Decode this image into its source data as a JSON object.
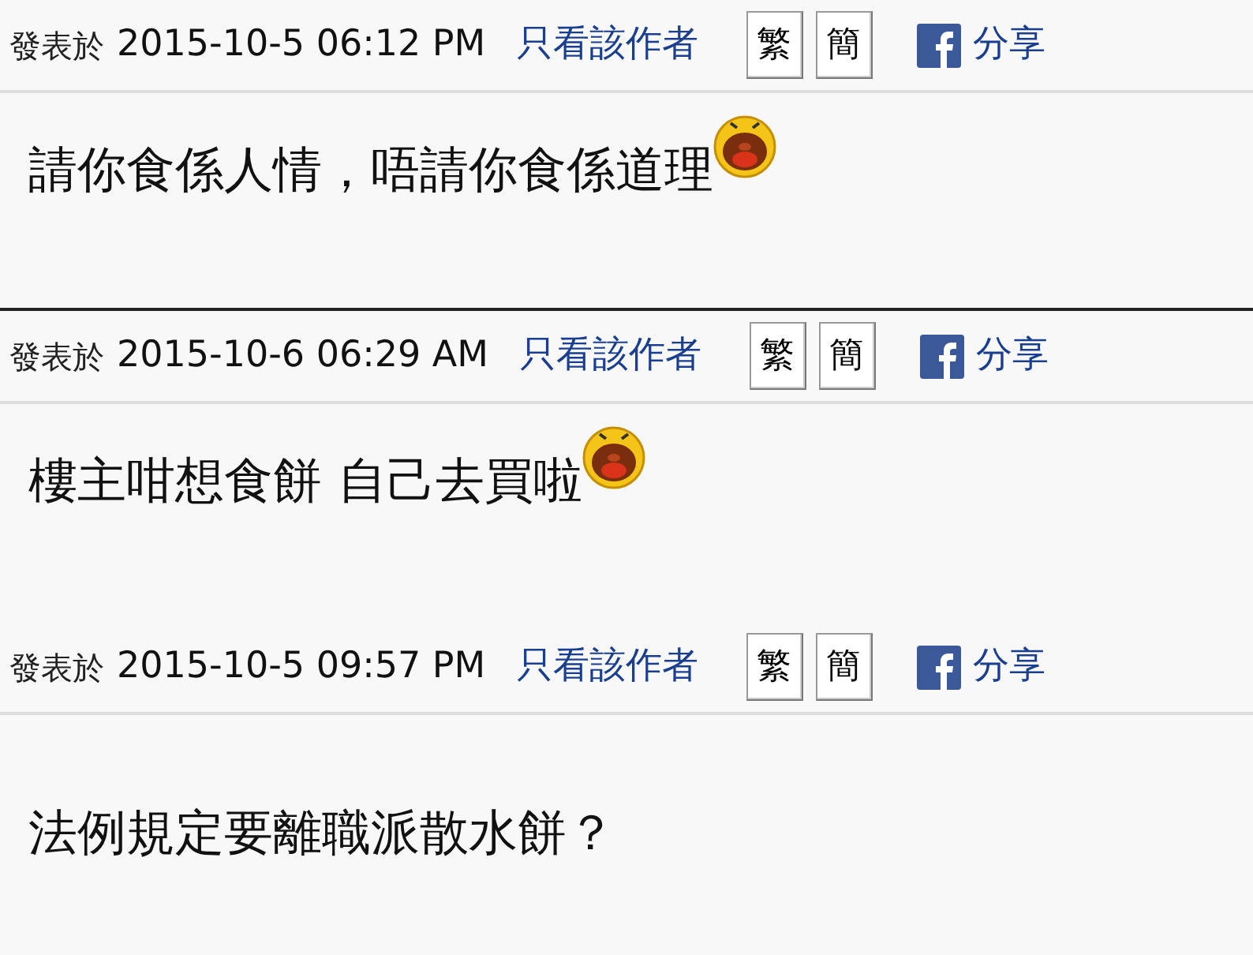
{
  "posts": [
    {
      "label": "發表於",
      "date": "2015-10-5 06:12 PM",
      "author_link": "只看該作者",
      "buttons": [
        "繁",
        "簡"
      ],
      "share": "分享",
      "text": "請你食係人情，唔請你食係道理",
      "emoticon": true,
      "separator": true
    },
    {
      "label": "發表於",
      "date": "2015-10-6 06:29 AM",
      "author_link": "只看該作者",
      "buttons": [
        "繁",
        "簡"
      ],
      "share": "分享",
      "text": "樓主咁想食餅 自己去買啦",
      "emoticon": true,
      "separator": false
    },
    {
      "label": "發表於",
      "date": "2015-10-5 09:57 PM",
      "author_link": "只看該作者",
      "buttons": [
        "繁",
        "簡"
      ],
      "share": "分享",
      "text": "法例規定要離職派散水餅？",
      "emoticon": false,
      "separator": false
    }
  ]
}
